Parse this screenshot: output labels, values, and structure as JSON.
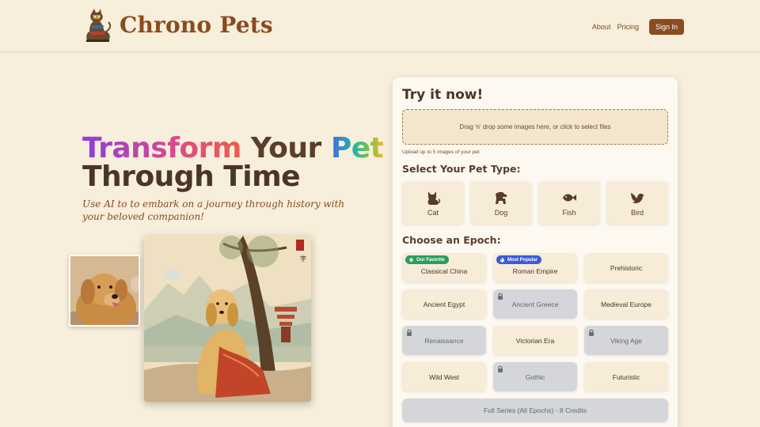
{
  "header": {
    "brand": "Chrono Pets",
    "nav": {
      "about": "About",
      "pricing": "Pricing"
    },
    "signin_label": "Sign In"
  },
  "hero": {
    "title_word1": "Transform",
    "title_word2": "Your",
    "title_word3": "Pet",
    "title_line2": "Through Time",
    "subtitle": "Use AI to to embark on a journey through history with your beloved companion!"
  },
  "panel": {
    "title": "Try it now!",
    "dropzone_text": "Drag 'n' drop some images here, or click to select files",
    "upload_note": "Upload up to 5 images of your pet",
    "pet_type_label": "Select Your Pet Type:",
    "pet_types": [
      {
        "label": "Cat",
        "icon": "cat-icon"
      },
      {
        "label": "Dog",
        "icon": "dog-icon"
      },
      {
        "label": "Fish",
        "icon": "fish-icon"
      },
      {
        "label": "Bird",
        "icon": "bird-icon"
      }
    ],
    "epoch_label": "Choose an Epoch:",
    "epochs": [
      {
        "label": "Classical China",
        "locked": false,
        "badge": "Our Favorite"
      },
      {
        "label": "Roman Empire",
        "locked": false,
        "badge": "Most Popular"
      },
      {
        "label": "Prehistoric",
        "locked": false
      },
      {
        "label": "Ancient Egypt",
        "locked": false
      },
      {
        "label": "Ancient Greece",
        "locked": true
      },
      {
        "label": "Medieval Europe",
        "locked": false
      },
      {
        "label": "Renaissance",
        "locked": true
      },
      {
        "label": "Victorian Era",
        "locked": false
      },
      {
        "label": "Viking Age",
        "locked": true
      },
      {
        "label": "Wild West",
        "locked": false
      },
      {
        "label": "Gothic",
        "locked": true
      },
      {
        "label": "Futuristic",
        "locked": false
      }
    ],
    "full_series_label": "Full Series (All Epochs) - 8 Credits"
  },
  "colors": {
    "background": "#f7eedc",
    "brand": "#8a4b1f",
    "badge_favorite": "#2a9d5c",
    "badge_popular": "#3b5bdb",
    "locked": "#d5d6da"
  }
}
